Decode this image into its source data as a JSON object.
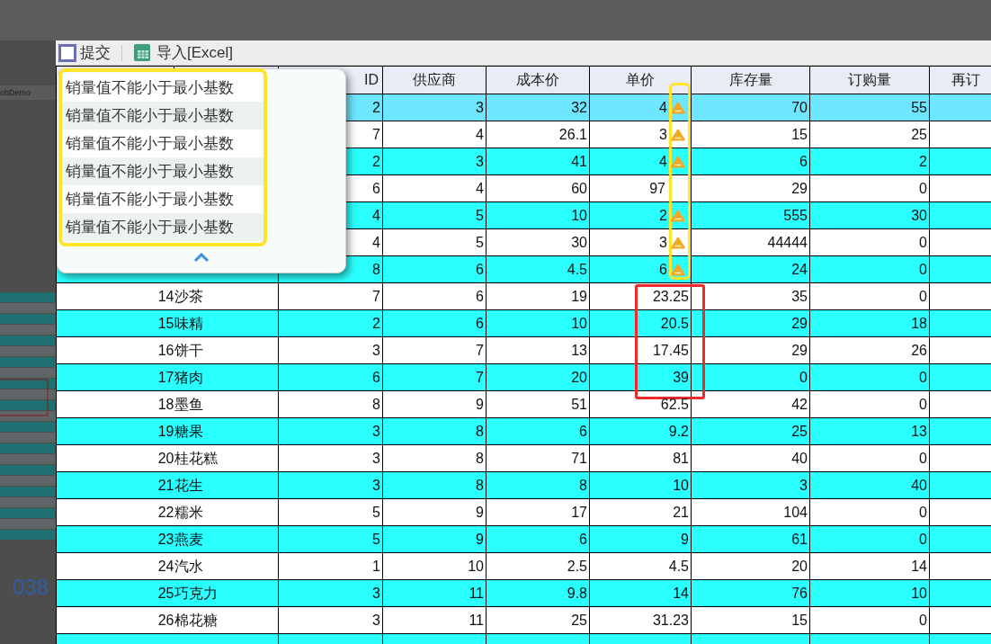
{
  "side_panel": {
    "app_label": "obDemo",
    "number": "038"
  },
  "toolbar": {
    "buttons": [
      {
        "kind": "submit",
        "label": "提交"
      },
      {
        "kind": "excel",
        "label": "导入[Excel]"
      }
    ]
  },
  "table": {
    "columns": [
      "",
      "",
      "ID",
      "供应商",
      "成本价",
      "单价",
      "库存量",
      "订购量",
      "再订"
    ],
    "rows": [
      {
        "category": "2",
        "supplier": "3",
        "cost": "32",
        "price": "4",
        "warning": true,
        "stock": "70",
        "order": "55",
        "color": "#6ee6ff",
        "boxed": false
      },
      {
        "category": "7",
        "supplier": "4",
        "cost": "26.1",
        "price": "3",
        "warning": true,
        "stock": "15",
        "order": "25",
        "color": "#ffffff",
        "boxed": false
      },
      {
        "category": "2",
        "supplier": "3",
        "cost": "41",
        "price": "4",
        "warning": true,
        "stock": "6",
        "order": "2",
        "color": "#2affff",
        "boxed": false
      },
      {
        "category": "6",
        "supplier": "4",
        "cost": "60",
        "price": "97",
        "warning": false,
        "stock": "29",
        "order": "0",
        "color": "#ffffff",
        "boxed": false
      },
      {
        "category": "4",
        "supplier": "5",
        "cost": "10",
        "price": "2",
        "warning": true,
        "stock": "555",
        "order": "30",
        "color": "#2affff",
        "boxed": false
      },
      {
        "category": "4",
        "supplier": "5",
        "cost": "30",
        "price": "3",
        "warning": true,
        "stock": "44444",
        "order": "0",
        "color": "#ffffff",
        "boxed": false
      },
      {
        "category": "8",
        "supplier": "6",
        "cost": "4.5",
        "price": "6",
        "warning": true,
        "stock": "24",
        "order": "0",
        "color": "#2affff",
        "boxed": false
      },
      {
        "id": "14",
        "name": "沙茶",
        "category": "7",
        "supplier": "6",
        "cost": "19",
        "price": "23.25",
        "warning": false,
        "stock": "35",
        "order": "0",
        "color": "#ffffff",
        "boxed": true
      },
      {
        "id": "15",
        "name": "味精",
        "category": "2",
        "supplier": "6",
        "cost": "10",
        "price": "20.5",
        "warning": false,
        "stock": "29",
        "order": "18",
        "color": "#2affff",
        "boxed": true
      },
      {
        "id": "16",
        "name": "饼干",
        "category": "3",
        "supplier": "7",
        "cost": "13",
        "price": "17.45",
        "warning": false,
        "stock": "29",
        "order": "26",
        "color": "#ffffff",
        "boxed": true
      },
      {
        "id": "17",
        "name": "猪肉",
        "category": "6",
        "supplier": "7",
        "cost": "20",
        "price": "39",
        "warning": false,
        "stock": "0",
        "order": "0",
        "color": "#2affff",
        "boxed": true
      },
      {
        "id": "18",
        "name": "墨鱼",
        "category": "8",
        "supplier": "9",
        "cost": "51",
        "price": "62.5",
        "warning": false,
        "stock": "42",
        "order": "0",
        "color": "#ffffff",
        "boxed": false
      },
      {
        "id": "19",
        "name": "糖果",
        "category": "3",
        "supplier": "8",
        "cost": "6",
        "price": "9.2",
        "warning": false,
        "stock": "25",
        "order": "13",
        "color": "#2affff",
        "boxed": false
      },
      {
        "id": "20",
        "name": "桂花糕",
        "category": "3",
        "supplier": "8",
        "cost": "71",
        "price": "81",
        "warning": false,
        "stock": "40",
        "order": "0",
        "color": "#ffffff",
        "boxed": false
      },
      {
        "id": "21",
        "name": "花生",
        "category": "3",
        "supplier": "8",
        "cost": "8",
        "price": "10",
        "warning": false,
        "stock": "3",
        "order": "40",
        "color": "#2affff",
        "boxed": false
      },
      {
        "id": "22",
        "name": "糯米",
        "category": "5",
        "supplier": "9",
        "cost": "17",
        "price": "21",
        "warning": false,
        "stock": "104",
        "order": "0",
        "color": "#ffffff",
        "boxed": false
      },
      {
        "id": "23",
        "name": "燕麦",
        "category": "5",
        "supplier": "9",
        "cost": "6",
        "price": "9",
        "warning": false,
        "stock": "61",
        "order": "0",
        "color": "#2affff",
        "boxed": false
      },
      {
        "id": "24",
        "name": "汽水",
        "category": "1",
        "supplier": "10",
        "cost": "2.5",
        "price": "4.5",
        "warning": false,
        "stock": "20",
        "order": "14",
        "color": "#ffffff",
        "boxed": false
      },
      {
        "id": "25",
        "name": "巧克力",
        "category": "3",
        "supplier": "11",
        "cost": "9.8",
        "price": "14",
        "warning": false,
        "stock": "76",
        "order": "10",
        "color": "#2affff",
        "boxed": false
      },
      {
        "id": "26",
        "name": "棉花糖",
        "category": "3",
        "supplier": "11",
        "cost": "25",
        "price": "31.23",
        "warning": false,
        "stock": "15",
        "order": "0",
        "color": "#ffffff",
        "boxed": false
      },
      {
        "color": "#2affff"
      }
    ]
  },
  "popup": {
    "highlighted": true,
    "messages": [
      "销量值不能小于最小基数",
      "销量值不能小于最小基数",
      "销量值不能小于最小基数",
      "销量值不能小于最小基数",
      "销量值不能小于最小基数",
      "销量值不能小于最小基数"
    ]
  }
}
